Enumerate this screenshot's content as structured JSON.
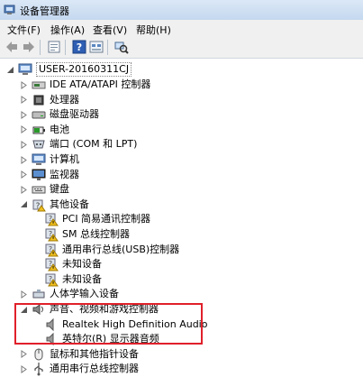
{
  "window": {
    "title": "设备管理器",
    "colors": {
      "highlight_box": "#e0202a",
      "warning_badge": "#f0c020"
    }
  },
  "menu": [
    {
      "label": "文件(F)"
    },
    {
      "label": "操作(A)"
    },
    {
      "label": "查看(V)"
    },
    {
      "label": "帮助(H)"
    }
  ],
  "toolbar": {
    "buttons": [
      "back-arrow-icon",
      "forward-arrow-icon",
      "properties-icon",
      "help-icon",
      "view-icon",
      "scan-hardware-icon"
    ]
  },
  "tree": {
    "root": "USER-20160311CJ",
    "items": [
      {
        "label": "IDE ATA/ATAPI 控制器",
        "icon": "ide-controller-icon"
      },
      {
        "label": "处理器",
        "icon": "processor-icon"
      },
      {
        "label": "磁盘驱动器",
        "icon": "disk-drive-icon"
      },
      {
        "label": "电池",
        "icon": "battery-icon"
      },
      {
        "label": "端口 (COM 和 LPT)",
        "icon": "port-icon"
      },
      {
        "label": "计算机",
        "icon": "computer-icon"
      },
      {
        "label": "监视器",
        "icon": "monitor-icon"
      },
      {
        "label": "键盘",
        "icon": "keyboard-icon"
      },
      {
        "label": "其他设备",
        "icon": "other-devices-icon"
      },
      {
        "label": "PCI 简易通讯控制器",
        "icon": "unknown-device-warning-icon"
      },
      {
        "label": "SM 总线控制器",
        "icon": "unknown-device-warning-icon"
      },
      {
        "label": "通用串行总线(USB)控制器",
        "icon": "unknown-device-warning-icon"
      },
      {
        "label": "未知设备",
        "icon": "unknown-device-warning-icon"
      },
      {
        "label": "未知设备",
        "icon": "unknown-device-warning-icon"
      },
      {
        "label": "人体学输入设备",
        "icon": "hid-icon"
      },
      {
        "label": "声音、视频和游戏控制器",
        "icon": "sound-icon"
      },
      {
        "label": "Realtek High Definition Audio",
        "icon": "speaker-icon"
      },
      {
        "label": "英特尔(R) 显示器音频",
        "icon": "speaker-icon"
      },
      {
        "label": "鼠标和其他指针设备",
        "icon": "mouse-icon"
      },
      {
        "label": "通用串行总线控制器",
        "icon": "usb-icon"
      }
    ]
  }
}
